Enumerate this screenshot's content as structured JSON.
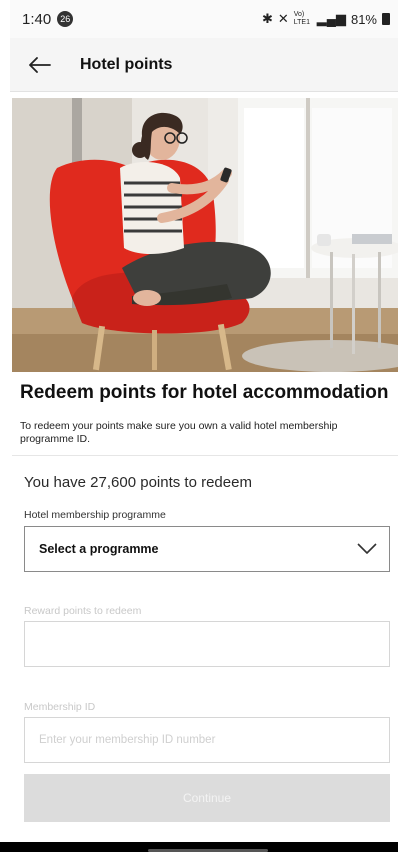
{
  "status_bar": {
    "time": "1:40",
    "notification_count": "26",
    "signal_labels": "Vo) LTE1",
    "battery": "81%"
  },
  "app_bar": {
    "title": "Hotel points"
  },
  "intro": {
    "heading": "Redeem points for hotel accommodation",
    "description": "To redeem your points make sure you own a valid hotel membership programme ID."
  },
  "form": {
    "points_summary": "You have 27,600 points to redeem",
    "programme_label": "Hotel membership programme",
    "programme_value": "Select a programme",
    "reward_label": "Reward points to redeem",
    "reward_value": "",
    "membership_label": "Membership ID",
    "membership_placeholder": "Enter your membership ID number",
    "continue_label": "Continue"
  },
  "colors": {
    "chair_red": "#e02a1e",
    "disabled_button": "#dcdcdc",
    "disabled_text": "#c8c8c8"
  }
}
